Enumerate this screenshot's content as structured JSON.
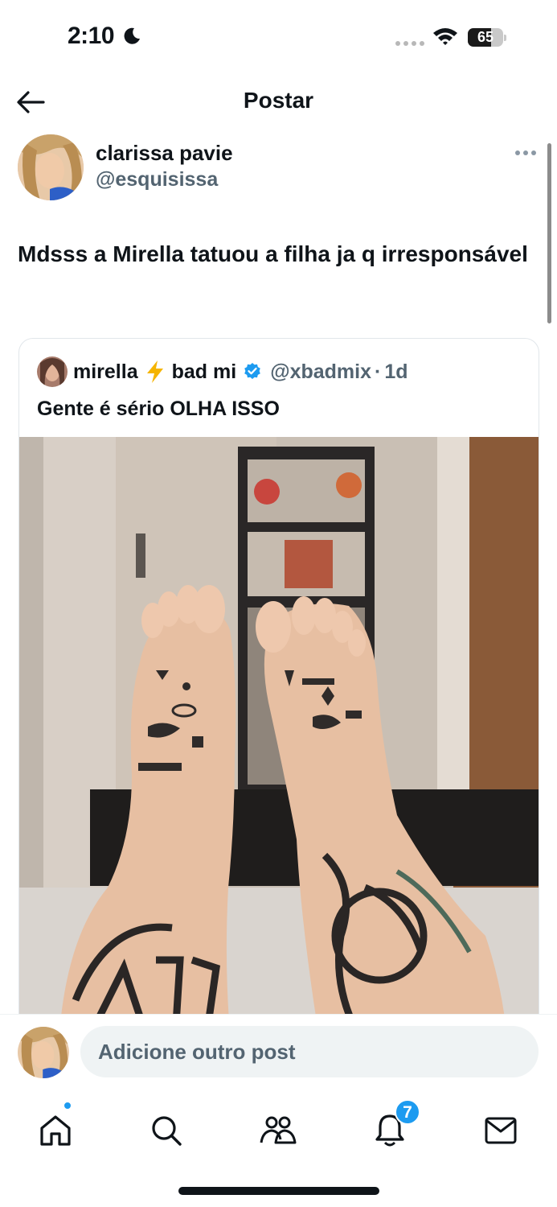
{
  "status_bar": {
    "time": "2:10",
    "battery": "65",
    "battery_level": 0.65,
    "icons": [
      "moon-icon",
      "signal-icon",
      "wifi-icon",
      "battery-icon"
    ]
  },
  "header": {
    "back_icon": "arrow-left-icon",
    "title": "Postar"
  },
  "post": {
    "author_name": "clarissa pavie",
    "author_handle": "@esquisissa",
    "more_icon": "more-horizontal-icon",
    "text": "Mdsss a Mirella tatuou a filha ja q irresponsável"
  },
  "quote": {
    "name": "mirella",
    "name_suffix": "bad mi",
    "bolt_icon": "lightning-bolt-icon",
    "verified_icon": "verified-badge-icon",
    "handle": "@xbadmix",
    "separator": "·",
    "time": "1d",
    "text": "Gente é sério OLHA ISSO",
    "media": "photo of tattooed feet"
  },
  "reply": {
    "placeholder": "Adicione outro post"
  },
  "nav": {
    "items": [
      {
        "icon": "home-icon",
        "label": "Home"
      },
      {
        "icon": "search-icon",
        "label": "Search"
      },
      {
        "icon": "communities-icon",
        "label": "Communities"
      },
      {
        "icon": "notifications-icon",
        "label": "Notifications"
      },
      {
        "icon": "messages-icon",
        "label": "Messages"
      }
    ],
    "notification_count": "7"
  },
  "colors": {
    "accent": "#1d9bf0",
    "text": "#0f1419",
    "secondary_text": "#536471",
    "bolt": "#f5b400"
  }
}
